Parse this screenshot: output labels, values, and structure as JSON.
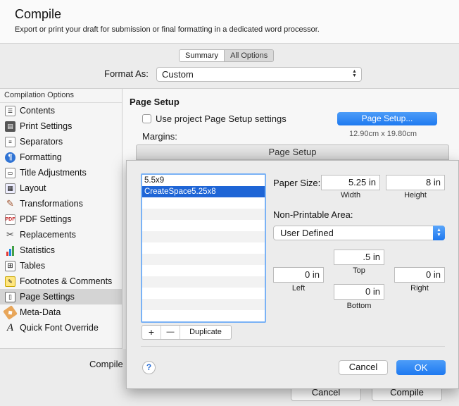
{
  "window": {
    "title": "Compile",
    "subtitle": "Export or print your draft for submission or final formatting in a dedicated word processor.",
    "tabs": [
      {
        "label": "Summary"
      },
      {
        "label": "All Options"
      }
    ],
    "format_label": "Format As:",
    "format_value": "Custom"
  },
  "sidebar": {
    "heading": "Compilation Options",
    "items": [
      {
        "label": "Contents",
        "icon": "contents-icon"
      },
      {
        "label": "Print Settings",
        "icon": "printer-icon"
      },
      {
        "label": "Separators",
        "icon": "separators-icon"
      },
      {
        "label": "Formatting",
        "icon": "formatting-icon"
      },
      {
        "label": "Title Adjustments",
        "icon": "title-adjustments-icon"
      },
      {
        "label": "Layout",
        "icon": "layout-icon"
      },
      {
        "label": "Transformations",
        "icon": "transformations-icon"
      },
      {
        "label": "PDF Settings",
        "icon": "pdf-icon"
      },
      {
        "label": "Replacements",
        "icon": "replacements-icon"
      },
      {
        "label": "Statistics",
        "icon": "statistics-icon"
      },
      {
        "label": "Tables",
        "icon": "tables-icon"
      },
      {
        "label": "Footnotes & Comments",
        "icon": "footnotes-icon"
      },
      {
        "label": "Page Settings",
        "icon": "page-settings-icon",
        "active": true
      },
      {
        "label": "Meta-Data",
        "icon": "tag-icon"
      },
      {
        "label": "Quick Font Override",
        "icon": "font-icon"
      }
    ]
  },
  "pane": {
    "title": "Page Setup",
    "use_project_label": "Use project Page Setup settings",
    "page_setup_button": "Page Setup...",
    "dimensions": "12.90cm x 19.80cm",
    "margins_label": "Margins:"
  },
  "footer": {
    "compile_label": "Compile",
    "cancel_button": "Cancel",
    "compile_button": "Compile"
  },
  "dialog": {
    "title": "Page Setup",
    "list_items": [
      "5.5x9",
      "CreateSpace5.25x8"
    ],
    "selected_index": 1,
    "add_button": "+",
    "remove_button": "—",
    "duplicate_button": "Duplicate",
    "paper_size_label": "Paper Size:",
    "width_value": "5.25 in",
    "width_caption": "Width",
    "height_value": "8 in",
    "height_caption": "Height",
    "non_printable_label": "Non-Printable Area:",
    "area_select": "User Defined",
    "top_value": ".5 in",
    "top_caption": "Top",
    "left_value": "0 in",
    "left_caption": "Left",
    "right_value": "0 in",
    "right_caption": "Right",
    "bottom_value": "0 in",
    "bottom_caption": "Bottom",
    "help": "?",
    "cancel_button": "Cancel",
    "ok_button": "OK"
  }
}
